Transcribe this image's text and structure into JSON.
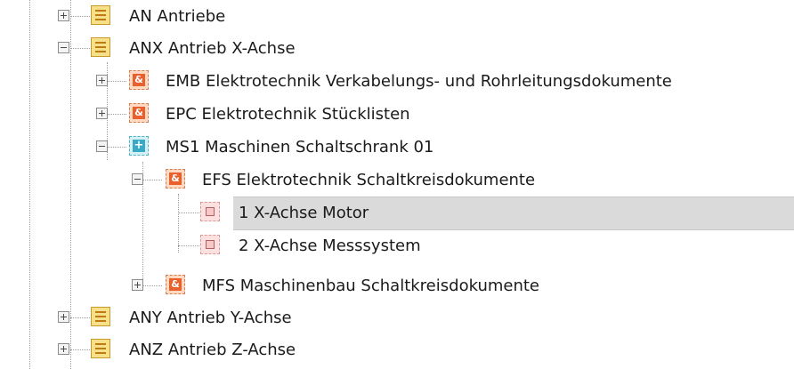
{
  "tree": {
    "items": [
      {
        "label": "AN Antriebe",
        "icon": "list-icon",
        "expanded": false
      },
      {
        "label": "ANX Antrieb X-Achse",
        "icon": "list-icon",
        "expanded": true
      },
      {
        "label": "EMB Elektrotechnik Verkabelungs- und Rohrleitungsdokumente",
        "icon": "ampersand-icon",
        "expanded": false
      },
      {
        "label": "EPC Elektrotechnik Stücklisten",
        "icon": "ampersand-icon",
        "expanded": false
      },
      {
        "label": "MS1 Maschinen Schaltschrank 01",
        "icon": "plus-box-icon",
        "expanded": true
      },
      {
        "label": "EFS Elektrotechnik Schaltkreisdokumente",
        "icon": "ampersand-icon",
        "expanded": true
      },
      {
        "label": "1 X-Achse Motor",
        "icon": "chip-icon",
        "selected": true
      },
      {
        "label": "2 X-Achse Messsystem",
        "icon": "chip-icon"
      },
      {
        "label": "MFS Maschinenbau Schaltkreisdokumente",
        "icon": "ampersand-icon",
        "expanded": false
      },
      {
        "label": "ANY Antrieb Y-Achse",
        "icon": "list-icon",
        "expanded": false
      },
      {
        "label": "ANZ Antrieb Z-Achse",
        "icon": "list-icon",
        "expanded": false
      }
    ]
  },
  "icon_glyphs": {
    "ampersand": "&",
    "plus": "+"
  },
  "colors": {
    "selection": "#dadada",
    "list_icon": "#f6e08a",
    "ampersand_icon": "#e8612d",
    "plus_icon": "#39a9c8"
  }
}
